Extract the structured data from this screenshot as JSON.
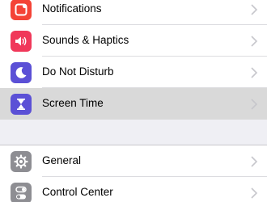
{
  "settings": {
    "group1": [
      {
        "label": "Notifications",
        "icon": "notifications-icon",
        "color": "#f44336"
      },
      {
        "label": "Sounds & Haptics",
        "icon": "speaker-icon",
        "color": "#f0385a"
      },
      {
        "label": "Do Not Disturb",
        "icon": "moon-icon",
        "color": "#5b50d6"
      },
      {
        "label": "Screen Time",
        "icon": "hourglass-icon",
        "color": "#5b50d6",
        "highlighted": true
      }
    ],
    "group2": [
      {
        "label": "General",
        "icon": "gear-icon",
        "color": "#8e8e93"
      },
      {
        "label": "Control Center",
        "icon": "toggles-icon",
        "color": "#8e8e93"
      }
    ]
  }
}
